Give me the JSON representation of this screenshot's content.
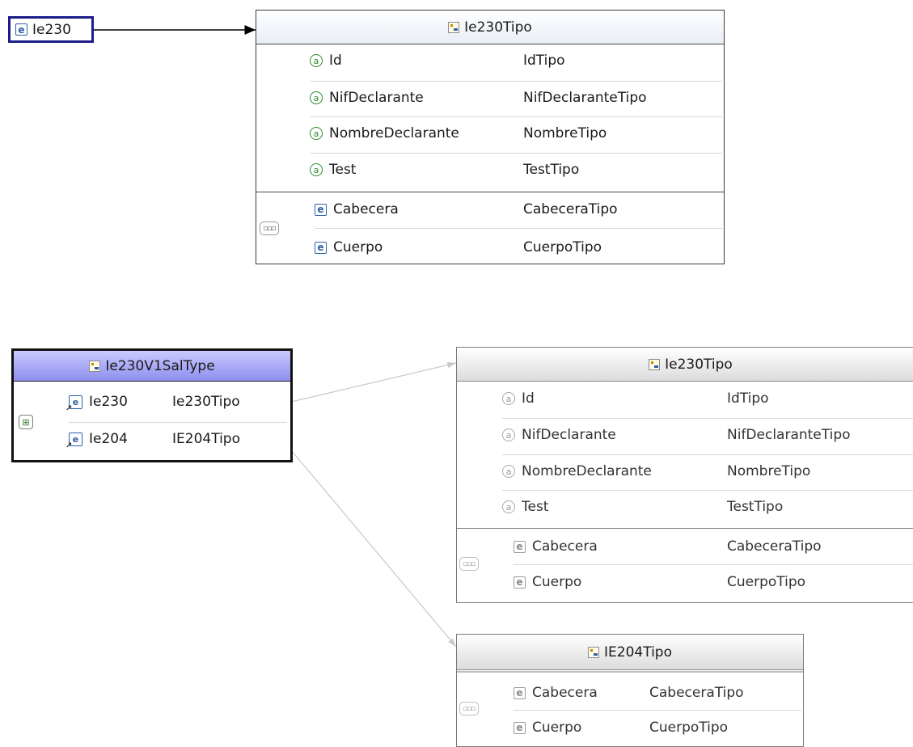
{
  "top_element": {
    "name": "Ie230"
  },
  "top_type": {
    "name": "Ie230Tipo",
    "attributes": [
      {
        "name": "Id",
        "type": "IdTipo"
      },
      {
        "name": "NifDeclarante",
        "type": "NifDeclaranteTipo"
      },
      {
        "name": "NombreDeclarante",
        "type": "NombreTipo"
      },
      {
        "name": "Test",
        "type": "TestTipo"
      }
    ],
    "elements": [
      {
        "name": "Cabecera",
        "type": "CabeceraTipo"
      },
      {
        "name": "Cuerpo",
        "type": "CuerpoTipo"
      }
    ]
  },
  "root_type": {
    "name": "Ie230V1SalType",
    "elements": [
      {
        "name": "Ie230",
        "type": "Ie230Tipo"
      },
      {
        "name": "Ie204",
        "type": "IE204Tipo"
      }
    ]
  },
  "ref_type_1": {
    "name": "Ie230Tipo",
    "attributes": [
      {
        "name": "Id",
        "type": "IdTipo"
      },
      {
        "name": "NifDeclarante",
        "type": "NifDeclaranteTipo"
      },
      {
        "name": "NombreDeclarante",
        "type": "NombreTipo"
      },
      {
        "name": "Test",
        "type": "TestTipo"
      }
    ],
    "elements": [
      {
        "name": "Cabecera",
        "type": "CabeceraTipo"
      },
      {
        "name": "Cuerpo",
        "type": "CuerpoTipo"
      }
    ]
  },
  "ref_type_2": {
    "name": "IE204Tipo",
    "elements": [
      {
        "name": "Cabecera",
        "type": "CabeceraTipo"
      },
      {
        "name": "Cuerpo",
        "type": "CuerpoTipo"
      }
    ]
  },
  "icons": {
    "element": "element-icon",
    "attribute": "attribute-icon",
    "complex_type": "complex-type-icon",
    "sequence": "sequence-icon",
    "choice": "choice-icon",
    "element_ref": "element-ref-icon"
  },
  "colors": {
    "element_node_border": "#1d1d8a",
    "root_header": "#a9a9f7",
    "attribute_green": "#2b8a2b",
    "element_blue": "#2d5fa8"
  }
}
